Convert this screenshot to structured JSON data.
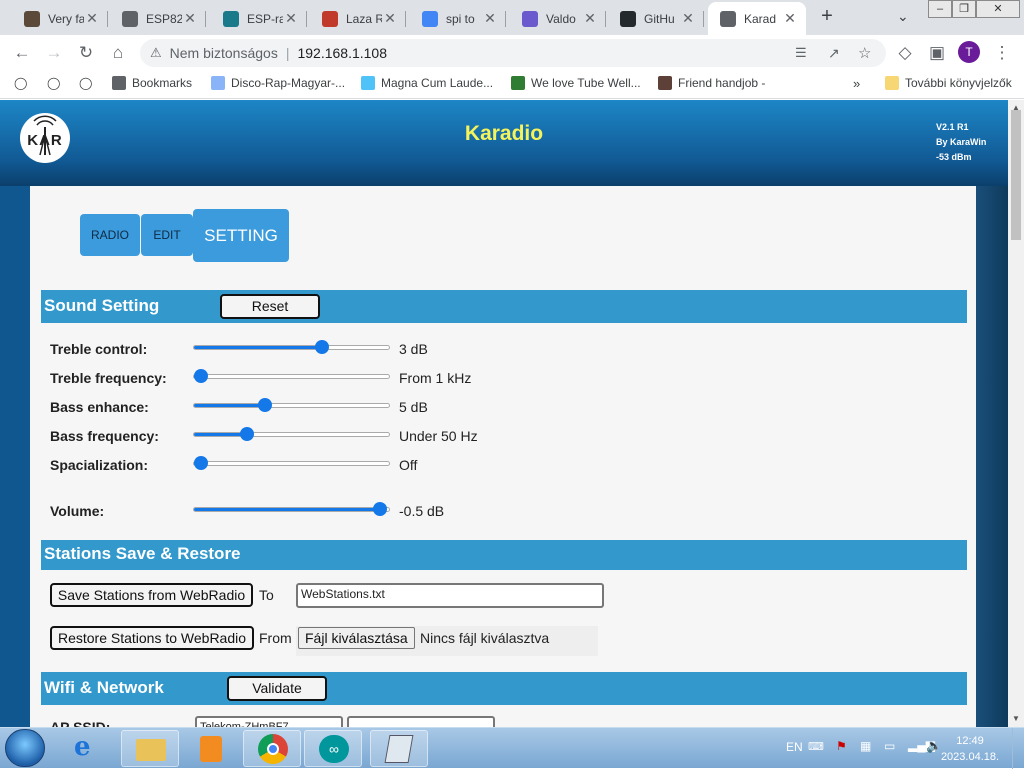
{
  "browser": {
    "tabs": [
      {
        "title": "Very fa",
        "color": "#5b4a3a"
      },
      {
        "title": "ESP82",
        "color": "#5f6368"
      },
      {
        "title": "ESP-ra",
        "color": "#1a7a8a"
      },
      {
        "title": "Laza R",
        "color": "#c0392b"
      },
      {
        "title": "spi to",
        "color": "#4285f4"
      },
      {
        "title": "Valdo",
        "color": "#6a5acd"
      },
      {
        "title": "GitHu",
        "color": "#24292e"
      },
      {
        "title": "Karad",
        "color": "#5f6368"
      }
    ],
    "address": {
      "security": "Nem biztonságos",
      "url": "192.168.1.108"
    },
    "profile_initial": "T",
    "bookmarks": [
      {
        "label": "Bookmarks",
        "color": "#5f6368"
      },
      {
        "label": "Disco-Rap-Magyar-...",
        "color": "#8ab4f8"
      },
      {
        "label": "Magna Cum Laude...",
        "color": "#4fc3f7"
      },
      {
        "label": "We love Tube Well...",
        "color": "#2e7d32"
      },
      {
        "label": "Friend handjob -",
        "color": "#5d4037"
      }
    ],
    "other_bookmarks": "További könyvjelzők"
  },
  "app": {
    "title": "Karadio",
    "logo_text": "KAR",
    "version_lines": [
      "V2.1 R1",
      "By KaraWin",
      "-53 dBm"
    ]
  },
  "nav": {
    "radio": "RADIO",
    "edit": "EDIT",
    "setting": "SETTING"
  },
  "sound": {
    "title": "Sound Setting",
    "reset": "Reset",
    "controls": [
      {
        "label": "Treble control:",
        "value": "3 dB",
        "level": 0.66
      },
      {
        "label": "Treble frequency:",
        "value": "From 1 kHz",
        "level": 0.0
      },
      {
        "label": "Bass enhance:",
        "value": "5 dB",
        "level": 0.35
      },
      {
        "label": "Bass frequency:",
        "value": "Under 50 Hz",
        "level": 0.25
      },
      {
        "label": "Spacialization:",
        "value": "Off",
        "level": 0.0
      },
      {
        "label": "Volume:",
        "value": "-0.5 dB",
        "level": 0.98
      }
    ]
  },
  "stations": {
    "title": "Stations Save & Restore",
    "save_button": "Save Stations from WebRadio",
    "to": "To",
    "filename": "WebStations.txt",
    "restore_button": "Restore Stations to WebRadio",
    "from": "From",
    "choose_file": "Fájl kiválasztása",
    "no_file": "Nincs fájl kiválasztva"
  },
  "wifi": {
    "title": "Wifi & Network",
    "validate": "Validate",
    "ap_label": "AP SSID:",
    "ap_value": "Telekom-ZHmBF7"
  },
  "taskbar": {
    "lang": "EN",
    "time": "12:49",
    "date": "2023.04.18."
  }
}
